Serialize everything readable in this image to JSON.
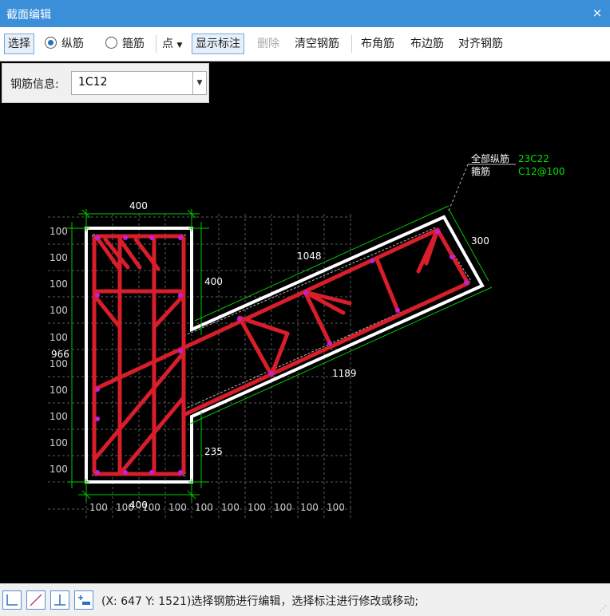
{
  "window": {
    "title": "截面编辑",
    "close_glyph": "×"
  },
  "toolbar": {
    "select": "选择",
    "longitudinal": "纵筋",
    "stirrup": "箍筋",
    "point": "点",
    "show_dims": "显示标注",
    "delete": "删除",
    "clear": "清空钢筋",
    "corner": "布角筋",
    "edge": "布边筋",
    "align": "对齐钢筋",
    "selected_mode": "纵筋"
  },
  "rebar_info": {
    "label": "钢筋信息:",
    "value": "1C12"
  },
  "drawing": {
    "annotation_all_label": "全部纵筋",
    "annotation_all_value": "23C22",
    "annotation_stirrup_label": "箍筋",
    "annotation_stirrup_value": "C12@100",
    "dim_top": "400",
    "dim_bottom": "400",
    "dim_left": "966",
    "dim_right_upper": "400",
    "dim_right_lower": "235",
    "dim_arm_top": "1048",
    "dim_arm_bottom": "1189",
    "dim_arm_end": "300",
    "grid_label": "100",
    "colors": {
      "concrete": "#ffffff",
      "rebar": "#d81e2a",
      "dim": "#00c800",
      "grid": "#5a5a5a",
      "note": "#00e000"
    }
  },
  "status": {
    "text": "(X: 647 Y: 1521)选择钢筋进行编辑，选择标注进行修改或移动;"
  }
}
